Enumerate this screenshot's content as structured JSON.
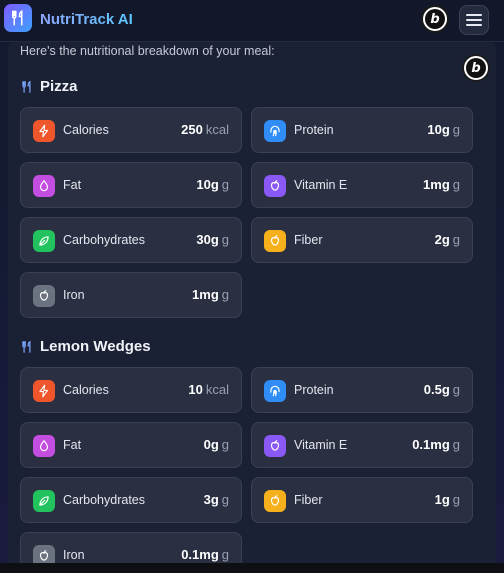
{
  "header": {
    "app_title": "NutriTrack AI",
    "logo_icon": "fork-knife-icon",
    "menu_icon": "hamburger-menu-icon",
    "avatar_letter": "b"
  },
  "intro_text": "Here's the nutritional breakdown of your meal:",
  "sections": [
    {
      "title": "Pizza",
      "items": [
        {
          "name": "Calories",
          "value": "250",
          "unit": "kcal",
          "icon": "lightning-icon",
          "color": "#f0562c"
        },
        {
          "name": "Protein",
          "value": "10g",
          "unit": "g",
          "icon": "fingerprint-icon",
          "color": "#2f8df5"
        },
        {
          "name": "Fat",
          "value": "10g",
          "unit": "g",
          "icon": "droplet-icon",
          "color": "#c44ee0"
        },
        {
          "name": "Vitamin E",
          "value": "1mg",
          "unit": "g",
          "icon": "apple-icon",
          "color": "#8a58f5"
        },
        {
          "name": "Carbohydrates",
          "value": "30g",
          "unit": "g",
          "icon": "leaf-icon",
          "color": "#22c35e"
        },
        {
          "name": "Fiber",
          "value": "2g",
          "unit": "g",
          "icon": "apple-icon",
          "color": "#f5b01c"
        },
        {
          "name": "Iron",
          "value": "1mg",
          "unit": "g",
          "icon": "apple-icon",
          "color": "#6b7280"
        }
      ]
    },
    {
      "title": "Lemon Wedges",
      "items": [
        {
          "name": "Calories",
          "value": "10",
          "unit": "kcal",
          "icon": "lightning-icon",
          "color": "#f0562c"
        },
        {
          "name": "Protein",
          "value": "0.5g",
          "unit": "g",
          "icon": "fingerprint-icon",
          "color": "#2f8df5"
        },
        {
          "name": "Fat",
          "value": "0g",
          "unit": "g",
          "icon": "droplet-icon",
          "color": "#c44ee0"
        },
        {
          "name": "Vitamin E",
          "value": "0.1mg",
          "unit": "g",
          "icon": "apple-icon",
          "color": "#8a58f5"
        },
        {
          "name": "Carbohydrates",
          "value": "3g",
          "unit": "g",
          "icon": "leaf-icon",
          "color": "#22c35e"
        },
        {
          "name": "Fiber",
          "value": "1g",
          "unit": "g",
          "icon": "apple-icon",
          "color": "#f5b01c"
        },
        {
          "name": "Iron",
          "value": "0.1mg",
          "unit": "g",
          "icon": "apple-icon",
          "color": "#6b7280"
        }
      ]
    }
  ]
}
